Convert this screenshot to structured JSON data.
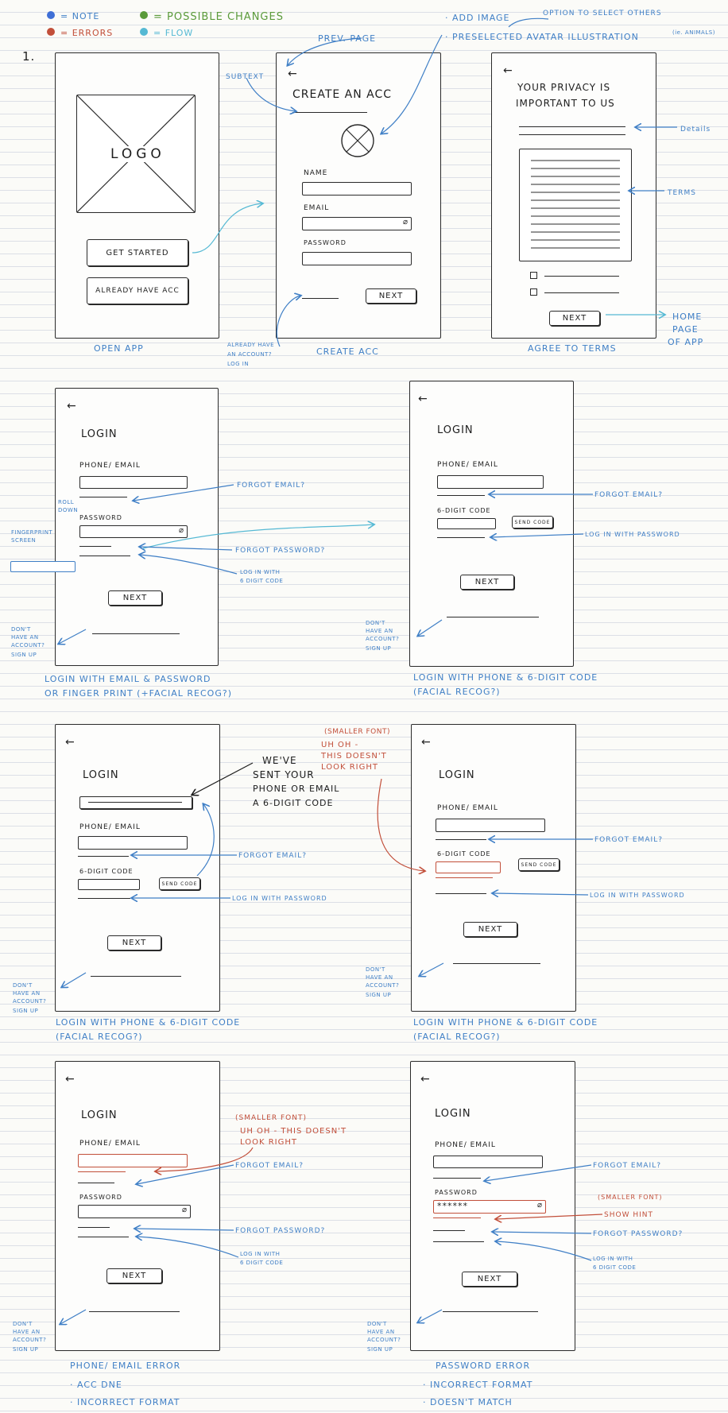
{
  "legend": {
    "note": "= NOTE",
    "errors": "= ERRORS",
    "possible_changes": "= POSSIBLE CHANGES",
    "flow": "= FLOW",
    "colors": {
      "note": "#3f6fd6",
      "errors": "#c24f3a",
      "possible": "#5a9a3a",
      "flow": "#55b9d4"
    }
  },
  "section_number": "1.",
  "top_notes": {
    "add_image": "· ADD IMAGE",
    "preselected": "· PRESELECTED AVATAR ILLUSTRATION",
    "ie_animals": "(ie. ANIMALS)",
    "option_select": "OPTION TO SELECT OTHERS",
    "prev_page": "PREV. PAGE",
    "subtext": "SUBTEXT",
    "details": "Details",
    "terms": "TERMS",
    "home_page": [
      "HOME",
      "PAGE",
      "OF APP"
    ],
    "already_account": [
      "ALREADY HAVE",
      "AN ACCOUNT?",
      "LOG IN"
    ]
  },
  "screens": {
    "open_app": {
      "logo": "LOGO",
      "get_started": "GET STARTED",
      "already": "ALREADY HAVE ACC",
      "caption": "OPEN APP"
    },
    "create_acc": {
      "title": "CREATE AN ACC",
      "name": "NAME",
      "email": "EMAIL",
      "password": "PASSWORD",
      "next": "NEXT",
      "caption": "CREATE ACC"
    },
    "agree": {
      "title": [
        "YOUR PRIVACY IS",
        "IMPORTANT TO US"
      ],
      "next": "NEXT",
      "caption": "AGREE TO TERMS"
    },
    "login1": {
      "title": "LOGIN",
      "phone_email": "PHONE/ EMAIL",
      "password": "PASSWORD",
      "next": "NEXT",
      "forgot_email": "FORGOT EMAIL?",
      "forgot_password": "FORGOT PASSWORD?",
      "login_code": [
        "LOG IN WITH",
        "6 DIGIT CODE"
      ],
      "fingerprint_label": [
        "FINGERPRINT",
        "SCREEN"
      ],
      "tiny_notes": [
        "ROLL",
        "DOWN"
      ],
      "caption": [
        "LOGIN WITH EMAIL & PASSWORD",
        "OR FINGER PRINT (+FACIAL RECOG?)"
      ]
    },
    "login2": {
      "title": "LOGIN",
      "phone_email": "PHONE/ EMAIL",
      "code": "6-DIGIT CODE",
      "send": "SEND CODE",
      "next": "NEXT",
      "forgot_email": "FORGOT EMAIL?",
      "login_pw": "LOG IN WITH PASSWORD",
      "caption": [
        "LOGIN WITH PHONE & 6-DIGIT CODE",
        "(FACIAL RECOG?)"
      ]
    },
    "login3": {
      "title": "LOGIN",
      "phone_email": "PHONE/ EMAIL",
      "code": "6-DIGIT CODE",
      "send": "SEND CODE",
      "next": "NEXT",
      "forgot_email": "FORGOT EMAIL?",
      "login_pw": "LOG IN WITH PASSWORD",
      "sent_note": [
        "WE'VE",
        "SENT YOUR",
        "PHONE OR EMAIL",
        "A 6-DIGIT CODE"
      ],
      "caption": [
        "LOGIN WITH PHONE & 6-DIGIT CODE",
        "(FACIAL RECOG?)"
      ]
    },
    "login4": {
      "title": "LOGIN",
      "phone_email": "PHONE/ EMAIL",
      "code": "6-DIGIT CODE",
      "send": "SEND CODE",
      "next": "NEXT",
      "forgot_email": "FORGOT EMAIL?",
      "login_pw": "LOG IN WITH PASSWORD",
      "error_note": [
        "(SMALLER FONT)",
        "UH OH -",
        "THIS DOESN'T",
        "LOOK RIGHT"
      ],
      "caption": [
        "LOGIN WITH PHONE & 6-DIGIT CODE",
        "(FACIAL RECOG?)"
      ]
    },
    "login5": {
      "title": "LOGIN",
      "phone_email": "PHONE/ EMAIL",
      "password": "PASSWORD",
      "next": "NEXT",
      "forgot_email": "FORGOT EMAIL?",
      "forgot_password": "FORGOT PASSWORD?",
      "login_code": [
        "LOG IN WITH",
        "6 DIGIT CODE"
      ],
      "error_note": [
        "(SMALLER FONT)",
        "UH OH - THIS DOESN'T",
        "LOOK RIGHT"
      ],
      "caption": [
        "PHONE/ EMAIL ERROR",
        "· ACC DNE",
        "· INCORRECT FORMAT"
      ]
    },
    "login6": {
      "title": "LOGIN",
      "phone_email": "PHONE/ EMAIL",
      "password": "PASSWORD",
      "masked": "******",
      "next": "NEXT",
      "forgot_email": "FORGOT EMAIL?",
      "forgot_password": "FORGOT PASSWORD?",
      "login_code": [
        "LOG IN WITH",
        "6 DIGIT CODE"
      ],
      "smaller_font": "(SMALLER FONT)",
      "show_hint": "SHOW HINT",
      "caption": [
        "PASSWORD ERROR",
        "· INCORRECT FORMAT",
        "· DOESN'T MATCH"
      ]
    }
  },
  "signup_note": [
    "DON'T",
    "HAVE AN",
    "ACCOUNT?",
    "SIGN UP"
  ]
}
